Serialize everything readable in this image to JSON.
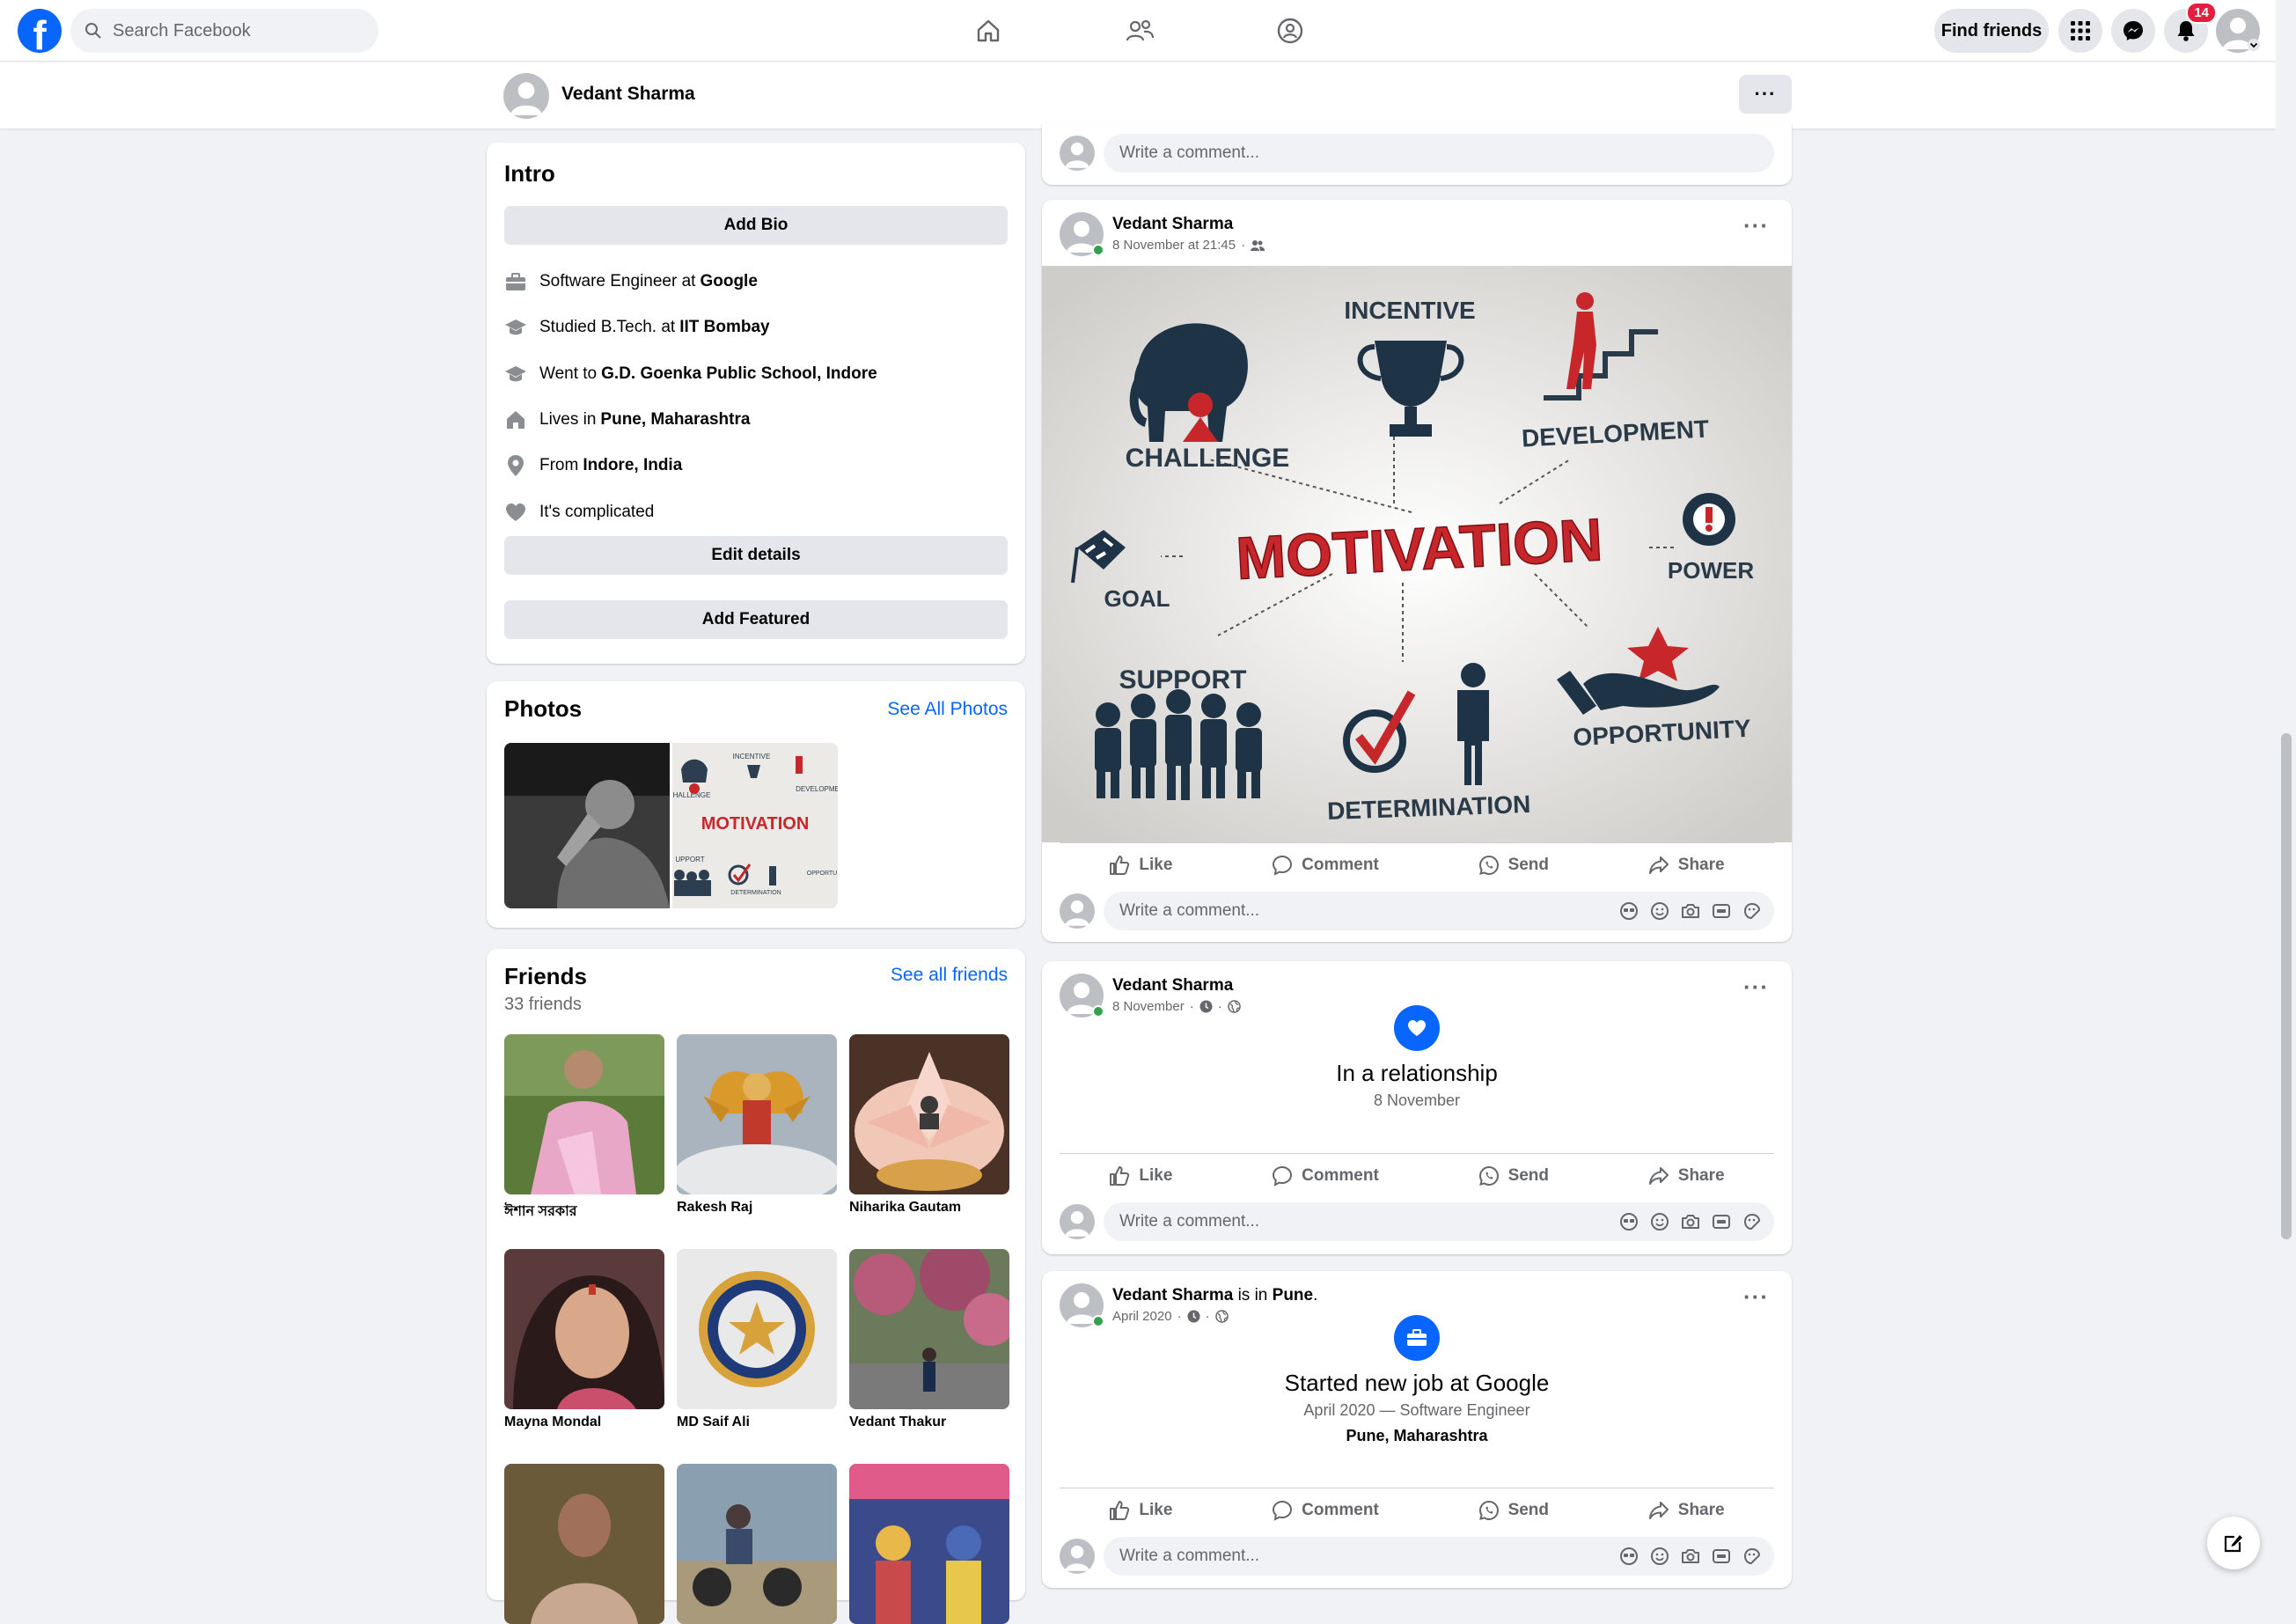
{
  "topbar": {
    "logo_letter": "f",
    "search_placeholder": "Search Facebook",
    "nav_icons": [
      "home-icon",
      "friends-icon",
      "groups-icon"
    ],
    "find_friends": "Find friends",
    "notification_count": "14",
    "icons": [
      "menu-grid-icon",
      "messenger-icon",
      "bell-icon"
    ]
  },
  "profile": {
    "name": "Vedant Sharma",
    "more": "···"
  },
  "intro": {
    "title": "Intro",
    "add_bio": "Add Bio",
    "rows": [
      {
        "prefix": "Software Engineer at",
        "bold": "Google"
      },
      {
        "prefix": "Studied B.Tech. at",
        "bold": "IIT Bombay"
      },
      {
        "prefix": "Went to",
        "bold": "G.D. Goenka Public School, Indore"
      },
      {
        "prefix": "Lives in",
        "bold": "Pune, Maharashtra"
      },
      {
        "prefix": "From",
        "bold": "Indore, India"
      },
      {
        "prefix": "It's complicated",
        "bold": ""
      }
    ],
    "edit_details": "Edit details",
    "add_featured": "Add Featured"
  },
  "photos": {
    "title": "Photos",
    "see_all": "See All Photos"
  },
  "friends": {
    "title": "Friends",
    "count": "33 friends",
    "see_all": "See all friends",
    "list": [
      {
        "name": "ঈশান সরকার"
      },
      {
        "name": "Rakesh Raj"
      },
      {
        "name": "Niharika Gautam"
      },
      {
        "name": "Mayna Mondal"
      },
      {
        "name": "MD Saif Ali"
      },
      {
        "name": "Vedant Thakur"
      },
      {
        "name": ""
      },
      {
        "name": ""
      },
      {
        "name": ""
      }
    ]
  },
  "motivation_image": {
    "center": "MOTIVATION",
    "words": [
      "INCENTIVE",
      "CHALLENGE",
      "DEVELOPMENT",
      "GOAL",
      "POWER",
      "SUPPORT",
      "OPPORTUNITY",
      "DETERMINATION"
    ]
  },
  "posts": {
    "comment_placeholder": "Write a comment...",
    "like": "Like",
    "comment": "Comment",
    "send": "Send",
    "share": "Share",
    "post1": {
      "name": "Vedant Sharma",
      "time": "8 November at 21:45"
    },
    "post2": {
      "name": "Vedant Sharma",
      "time": "8 November",
      "event_title": "In a relationship",
      "event_date": "8 November"
    },
    "post3": {
      "name": "Vedant Sharma",
      "is_in": "is in",
      "place": "Pune",
      "time": "April 2020",
      "event_title": "Started new job at Google",
      "event_sub": "April 2020 — Software Engineer",
      "event_loc": "Pune, Maharashtra"
    }
  }
}
